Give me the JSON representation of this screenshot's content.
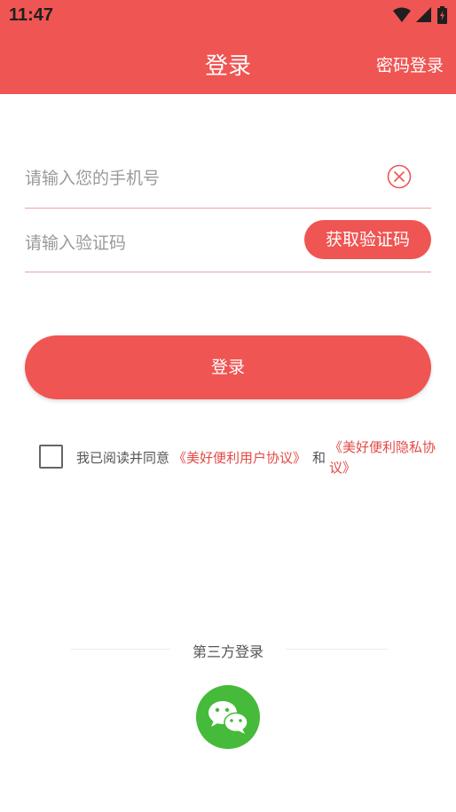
{
  "status_bar": {
    "time": "11:47"
  },
  "header": {
    "title": "登录",
    "password_login": "密码登录"
  },
  "form": {
    "phone_placeholder": "请输入您的手机号",
    "code_placeholder": "请输入验证码",
    "get_code_label": "获取验证码",
    "login_label": "登录"
  },
  "agreement": {
    "prefix": "我已阅读并同意",
    "user_agreement": "《美好便利用户协议》",
    "and": "和",
    "privacy_policy": "《美好便利隐私协议》"
  },
  "third_party": {
    "label": "第三方登录",
    "wechat_icon": "wechat-icon"
  },
  "colors": {
    "primary": "#ef5552",
    "link": "#e24a46",
    "wechat": "#46ba3a"
  }
}
